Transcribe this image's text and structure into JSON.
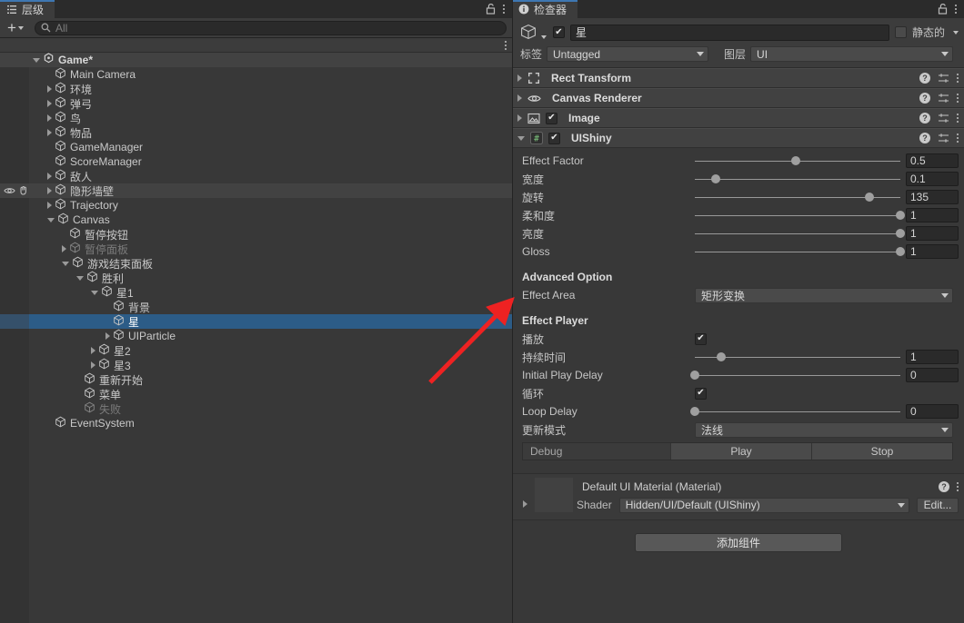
{
  "hierarchy": {
    "tab_label": "层级",
    "tab_icon": "list-icon",
    "add_label": "+",
    "search": {
      "placeholder": "All",
      "value": ""
    },
    "lock_icon": "lock-icon",
    "menu_icon": "kebab-icon",
    "items": [
      {
        "label": "Game*",
        "indent": 0,
        "toggle": "open",
        "bold": true,
        "dim": false,
        "selected": false,
        "header": true
      },
      {
        "label": "Main Camera",
        "indent": 1,
        "toggle": "none",
        "bold": false,
        "dim": false,
        "selected": false,
        "header": false
      },
      {
        "label": "环境",
        "indent": 1,
        "toggle": "closed",
        "bold": false,
        "dim": false,
        "selected": false,
        "header": false
      },
      {
        "label": "弹弓",
        "indent": 1,
        "toggle": "closed",
        "bold": false,
        "dim": false,
        "selected": false,
        "header": false
      },
      {
        "label": "鸟",
        "indent": 1,
        "toggle": "closed",
        "bold": false,
        "dim": false,
        "selected": false,
        "header": false
      },
      {
        "label": "物品",
        "indent": 1,
        "toggle": "closed",
        "bold": false,
        "dim": false,
        "selected": false,
        "header": false
      },
      {
        "label": "GameManager",
        "indent": 1,
        "toggle": "none",
        "bold": false,
        "dim": false,
        "selected": false,
        "header": false
      },
      {
        "label": "ScoreManager",
        "indent": 1,
        "toggle": "none",
        "bold": false,
        "dim": false,
        "selected": false,
        "header": false
      },
      {
        "label": "敌人",
        "indent": 1,
        "toggle": "closed",
        "bold": false,
        "dim": false,
        "selected": false,
        "header": false
      },
      {
        "label": "隐形墙壁",
        "indent": 1,
        "toggle": "closed",
        "bold": false,
        "dim": false,
        "selected": false,
        "header": false,
        "hover": true,
        "eye": true,
        "hand": true
      },
      {
        "label": "Trajectory",
        "indent": 1,
        "toggle": "closed",
        "bold": false,
        "dim": false,
        "selected": false,
        "header": false
      },
      {
        "label": "Canvas",
        "indent": 1,
        "toggle": "open",
        "bold": false,
        "dim": false,
        "selected": false,
        "header": false
      },
      {
        "label": "暂停按钮",
        "indent": 2,
        "toggle": "none",
        "bold": false,
        "dim": false,
        "selected": false,
        "header": false
      },
      {
        "label": "暂停面板",
        "indent": 2,
        "toggle": "closed",
        "bold": false,
        "dim": true,
        "selected": false,
        "header": false
      },
      {
        "label": "游戏结束面板",
        "indent": 2,
        "toggle": "open",
        "bold": false,
        "dim": false,
        "selected": false,
        "header": false
      },
      {
        "label": "胜利",
        "indent": 3,
        "toggle": "open",
        "bold": false,
        "dim": false,
        "selected": false,
        "header": false
      },
      {
        "label": "星1",
        "indent": 4,
        "toggle": "open",
        "bold": false,
        "dim": false,
        "selected": false,
        "header": false
      },
      {
        "label": "背景",
        "indent": 5,
        "toggle": "none",
        "bold": false,
        "dim": false,
        "selected": false,
        "header": false
      },
      {
        "label": "星",
        "indent": 5,
        "toggle": "none",
        "bold": false,
        "dim": false,
        "selected": true,
        "header": false
      },
      {
        "label": "UIParticle",
        "indent": 5,
        "toggle": "closed",
        "bold": false,
        "dim": false,
        "selected": false,
        "header": false
      },
      {
        "label": "星2",
        "indent": 4,
        "toggle": "closed",
        "bold": false,
        "dim": false,
        "selected": false,
        "header": false
      },
      {
        "label": "星3",
        "indent": 4,
        "toggle": "closed",
        "bold": false,
        "dim": false,
        "selected": false,
        "header": false
      },
      {
        "label": "重新开始",
        "indent": 3,
        "toggle": "none",
        "bold": false,
        "dim": false,
        "selected": false,
        "header": false
      },
      {
        "label": "菜单",
        "indent": 3,
        "toggle": "none",
        "bold": false,
        "dim": false,
        "selected": false,
        "header": false
      },
      {
        "label": "失败",
        "indent": 3,
        "toggle": "none",
        "bold": false,
        "dim": true,
        "selected": false,
        "header": false
      },
      {
        "label": "EventSystem",
        "indent": 1,
        "toggle": "none",
        "bold": false,
        "dim": false,
        "selected": false,
        "header": false
      }
    ]
  },
  "inspector": {
    "tab_label": "检查器",
    "tab_icon": "info-icon",
    "lock_icon": "lock-icon",
    "menu_icon": "kebab-icon",
    "game_object": {
      "enabled": true,
      "name": "星",
      "static_label": "静态的",
      "static_checked": false,
      "tag_label": "标签",
      "tag_value": "Untagged",
      "layer_label": "图层",
      "layer_value": "UI"
    },
    "components": [
      {
        "title": "Rect Transform",
        "icon": "rect-transform-icon",
        "expanded": false,
        "has_checkbox": false,
        "checked": false
      },
      {
        "title": "Canvas Renderer",
        "icon": "eye-icon",
        "expanded": false,
        "has_checkbox": false,
        "checked": false
      },
      {
        "title": "Image",
        "icon": "image-icon",
        "expanded": false,
        "has_checkbox": true,
        "checked": true
      },
      {
        "title": "UIShiny",
        "icon": "script-icon",
        "expanded": true,
        "has_checkbox": true,
        "checked": true
      }
    ],
    "uishiny": {
      "sliders": [
        {
          "label": "Effect Factor",
          "value": "0.5",
          "pos": 49
        },
        {
          "label": "宽度",
          "value": "0.1",
          "pos": 10
        },
        {
          "label": "旋转",
          "value": "135",
          "pos": 85
        },
        {
          "label": "柔和度",
          "value": "1",
          "pos": 100
        },
        {
          "label": "亮度",
          "value": "1",
          "pos": 100
        },
        {
          "label": "Gloss",
          "value": "1",
          "pos": 100
        }
      ],
      "advanced_title": "Advanced Option",
      "effect_area_label": "Effect Area",
      "effect_area_value": "矩形变换",
      "player_title": "Effect Player",
      "play_label": "播放",
      "play_checked": true,
      "duration_label": "持续时间",
      "duration_value": "1",
      "duration_pos": 13,
      "initial_delay_label": "Initial Play Delay",
      "initial_delay_value": "0",
      "initial_delay_pos": 0,
      "loop_label": "循环",
      "loop_checked": true,
      "loop_delay_label": "Loop Delay",
      "loop_delay_value": "0",
      "loop_delay_pos": 0,
      "update_mode_label": "更新模式",
      "update_mode_value": "法线",
      "debug_label": "Debug",
      "play_button_label": "Play",
      "stop_button_label": "Stop"
    },
    "material": {
      "title": "Default UI Material (Material)",
      "shader_label": "Shader",
      "shader_value": "Hidden/UI/Default (UIShiny)",
      "edit_label": "Edit..."
    },
    "add_component_label": "添加组件"
  },
  "annotation": {
    "arrow_color": "#ee2222",
    "name": "red-arrow-annotation"
  }
}
